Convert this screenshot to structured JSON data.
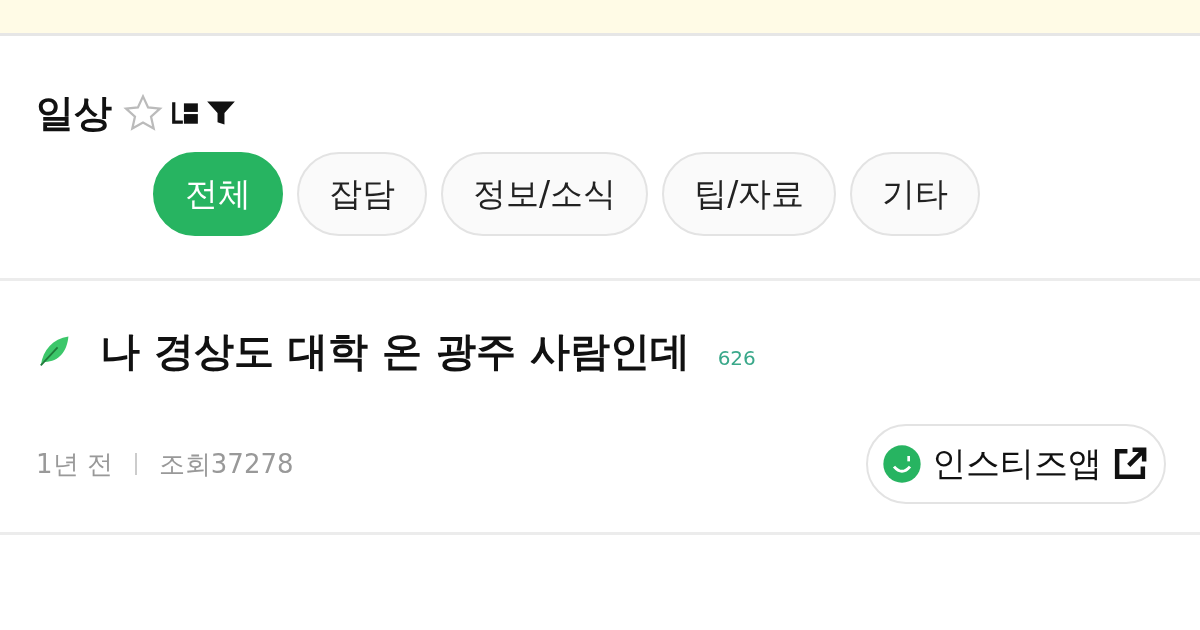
{
  "board": {
    "title": "일상",
    "starred": false
  },
  "tabs": [
    {
      "label": "전체",
      "selected": true
    },
    {
      "label": "잡담",
      "selected": false
    },
    {
      "label": "정보/소식",
      "selected": false
    },
    {
      "label": "팁/자료",
      "selected": false
    },
    {
      "label": "기타",
      "selected": false
    }
  ],
  "post": {
    "title": "나 경상도 대학 온 광주 사람인데",
    "comments": "626",
    "time": "1년 전",
    "views": "조회37278"
  },
  "app_button": {
    "label": "인스티즈앱"
  }
}
